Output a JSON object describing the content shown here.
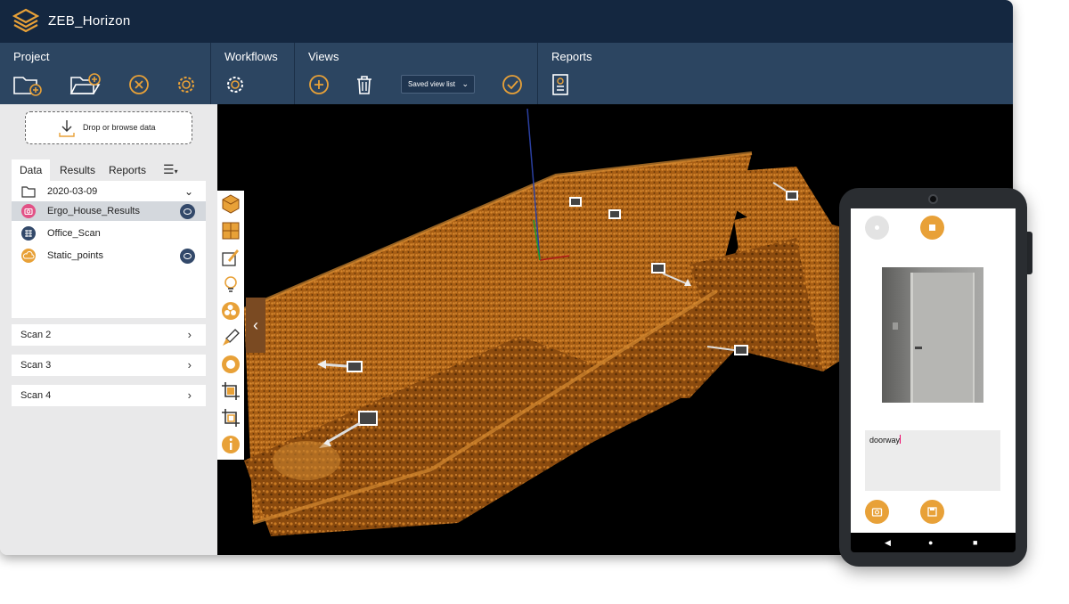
{
  "app": {
    "title": "ZEB_Horizon",
    "accent": "#e8a138",
    "titlebar_color": "#142740",
    "ribbon_color": "#2c4561"
  },
  "ribbon": {
    "groups": [
      {
        "label": "Project",
        "buttons": [
          "new-project-icon",
          "open-folder-icon",
          "close-project-icon",
          "settings-icon"
        ]
      },
      {
        "label": "Workflows",
        "buttons": [
          "workflow-settings-icon"
        ]
      },
      {
        "label": "Views",
        "buttons": [
          "add-view-icon",
          "delete-view-icon",
          "apply-view-icon"
        ],
        "saved_view_select": "Saved view list"
      },
      {
        "label": "Reports",
        "buttons": [
          "report-icon"
        ]
      }
    ]
  },
  "sidebar": {
    "drop_label": "Drop or browse data",
    "tabs": [
      "Data",
      "Results",
      "Reports"
    ],
    "active_tab": "Data",
    "menu_icon": "hamburger-menu-icon",
    "folder": {
      "label": "2020-03-09",
      "icon": "folder-icon"
    },
    "items": [
      {
        "label": "Ergo_House_Results",
        "icon": "camera-icon",
        "icon_color": "#e25186",
        "visible_toggle": true,
        "selected": true
      },
      {
        "label": "Office_Scan",
        "icon": "grid-icon",
        "icon_color": "#33496a",
        "visible_toggle": false,
        "selected": false
      },
      {
        "label": "Static_points",
        "icon": "cloud-icon",
        "icon_color": "#e8a138",
        "visible_toggle": true,
        "selected": false
      }
    ],
    "scans": [
      "Scan 2",
      "Scan 3",
      "Scan 4"
    ]
  },
  "toolstrip": {
    "tools": [
      "cube-view-icon",
      "top-view-icon",
      "paint-icon",
      "light-icon",
      "color-map-icon",
      "brush-icon",
      "target-icon",
      "crop-icon",
      "crop-box-icon",
      "info-icon"
    ]
  },
  "viewport": {
    "cloud_color": "#b86a1a",
    "background": "#000000"
  },
  "phone": {
    "note_text": "doorway",
    "buttons": [
      "record-icon",
      "stop-icon",
      "camera-capture-icon",
      "save-icon"
    ],
    "nav": [
      "back-icon",
      "home-icon",
      "recents-icon"
    ]
  }
}
